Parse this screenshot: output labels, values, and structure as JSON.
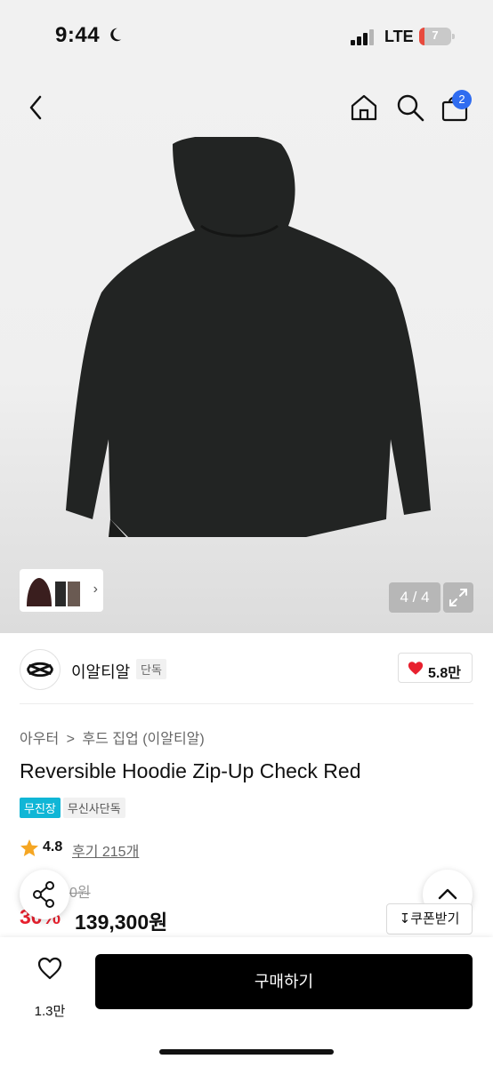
{
  "status_bar": {
    "time": "9:44",
    "network": "LTE",
    "battery_percent": "7",
    "battery_level": 0.07
  },
  "nav": {
    "cart_badge": "2"
  },
  "gallery": {
    "counter": "4 / 4",
    "product_color": "#222423"
  },
  "brand": {
    "name": "이알티알",
    "tag": "단독",
    "likes": "5.8만"
  },
  "product": {
    "breadcrumb": [
      "아우터",
      "후드 집업 (이알티알)"
    ],
    "breadcrumb_separator": ">",
    "title": "Reversible Hoodie Zip-Up Check Red",
    "tags": [
      "무진장",
      "무신사단독"
    ],
    "rating": "4.8",
    "review_label": "후기 215개",
    "original_price_partial": "0원",
    "discount": "30%",
    "price": "139,300원",
    "coupon_label": "쿠폰받기"
  },
  "bottom": {
    "wish_count": "1.3만",
    "buy_label": "구매하기"
  },
  "colors": {
    "accent_blue": "#2f6cf0",
    "discount_red": "#e8202e",
    "heart_red": "#e8202e",
    "tag_cyan": "#10b6d6",
    "star_orange": "#f5a623"
  }
}
